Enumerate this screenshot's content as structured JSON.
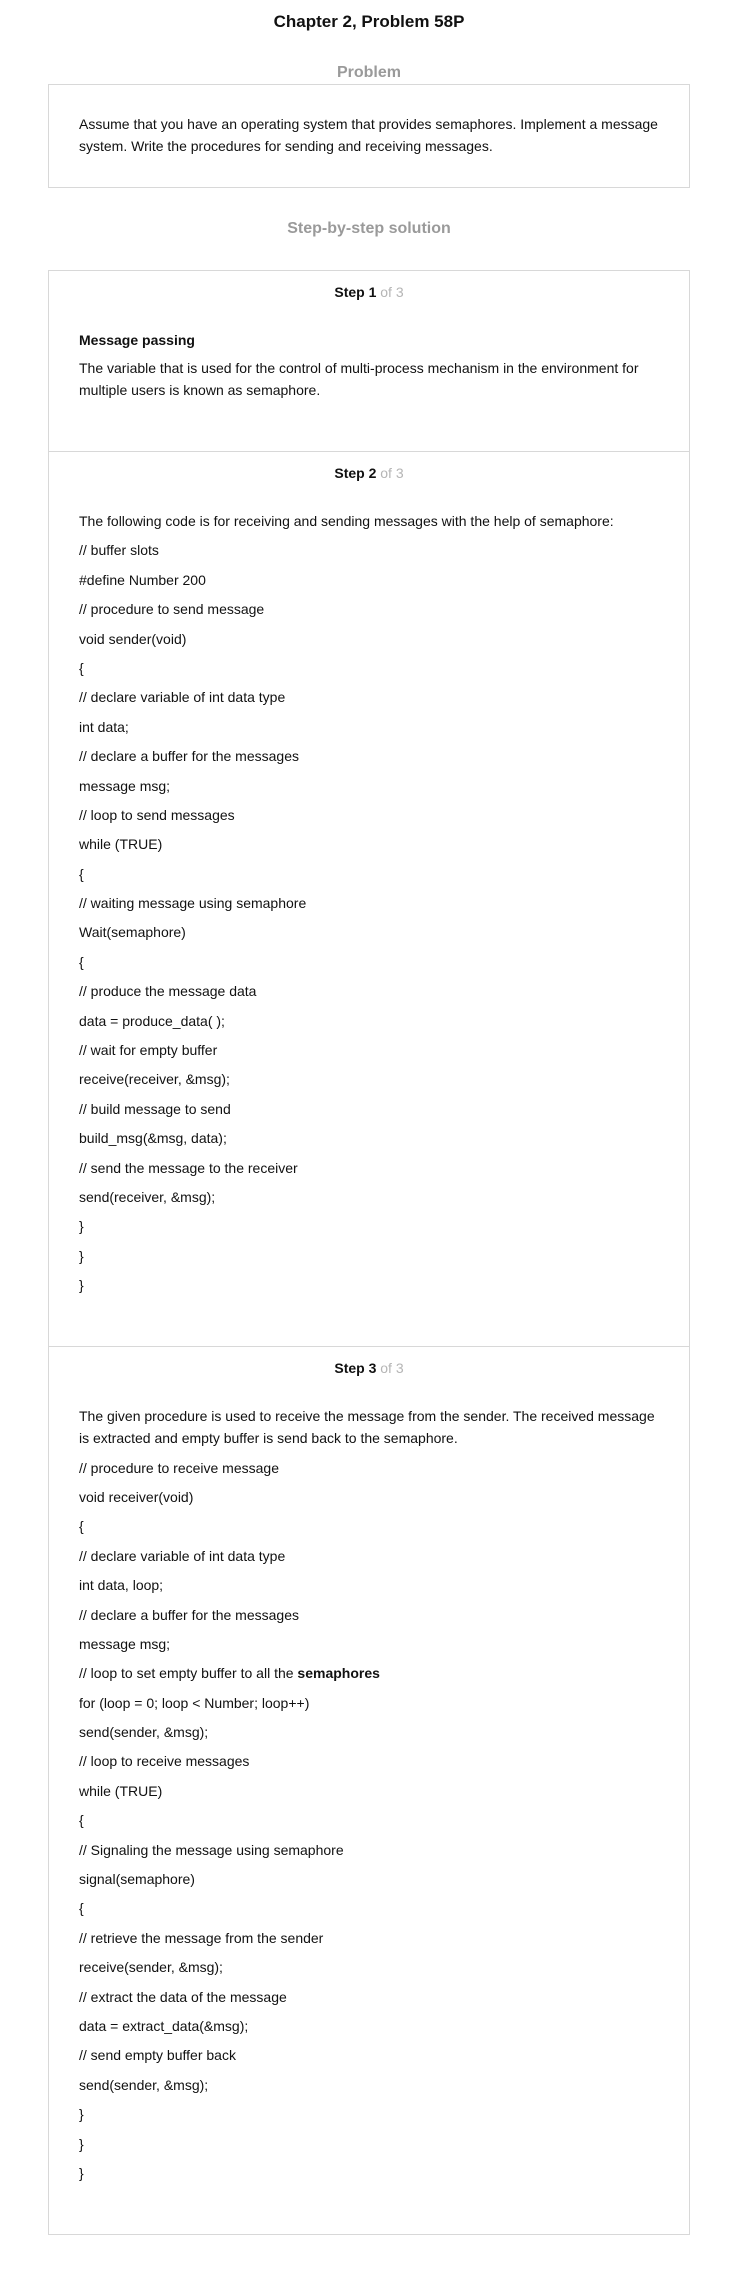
{
  "page_title": "Chapter 2, Problem 58P",
  "problem_heading": "Problem",
  "problem_text": "Assume that you have an operating system that provides semaphores. Implement a message system. Write the procedures for sending and receiving messages.",
  "solution_heading": "Step-by-step solution",
  "steps": [
    {
      "label": "Step 1",
      "of": " of 3",
      "heading": "Message passing",
      "lines": [
        "The variable that is used for the control of multi-process mechanism in the environment for multiple users is known as semaphore."
      ]
    },
    {
      "label": "Step 2",
      "of": " of 3",
      "lines": [
        "The following code is for receiving and sending messages with the help of semaphore:",
        "// buffer slots",
        "#define Number 200",
        "// procedure to send message",
        "void sender(void)",
        "{",
        "// declare variable of int data type",
        "int data;",
        "// declare a buffer for the messages",
        "message msg;",
        "// loop to send messages",
        "while (TRUE)",
        "{",
        "// waiting message using semaphore",
        "Wait(semaphore)",
        "{",
        "// produce the message data",
        "data = produce_data( );",
        "// wait for empty buffer",
        "receive(receiver, &msg);",
        "// build message to send",
        "build_msg(&msg, data);",
        "// send the message to the receiver",
        "send(receiver, &msg);",
        "}",
        "}",
        "}"
      ]
    },
    {
      "label": "Step 3",
      "of": " of 3",
      "lines": [
        "The given procedure is used to receive the message from the sender. The received message is extracted and empty buffer is send back to the semaphore.",
        "// procedure to receive message",
        "void receiver(void)",
        "{",
        "// declare variable of int data type",
        "int data, loop;",
        "// declare a buffer for the messages",
        "message msg;",
        "// loop to set empty buffer to all the ",
        "for (loop = 0; loop < Number; loop++)",
        "send(sender, &msg);",
        "// loop to receive messages",
        "while (TRUE)",
        "{",
        "// Signaling the message using semaphore",
        "signal(semaphore)",
        "{",
        "// retrieve the message from the sender",
        "receive(sender, &msg);",
        "// extract the data of the message",
        "data = extract_data(&msg);",
        "// send empty buffer back",
        "send(sender, &msg);",
        "}",
        "}",
        "}"
      ],
      "bold_word": "semaphores"
    }
  ]
}
